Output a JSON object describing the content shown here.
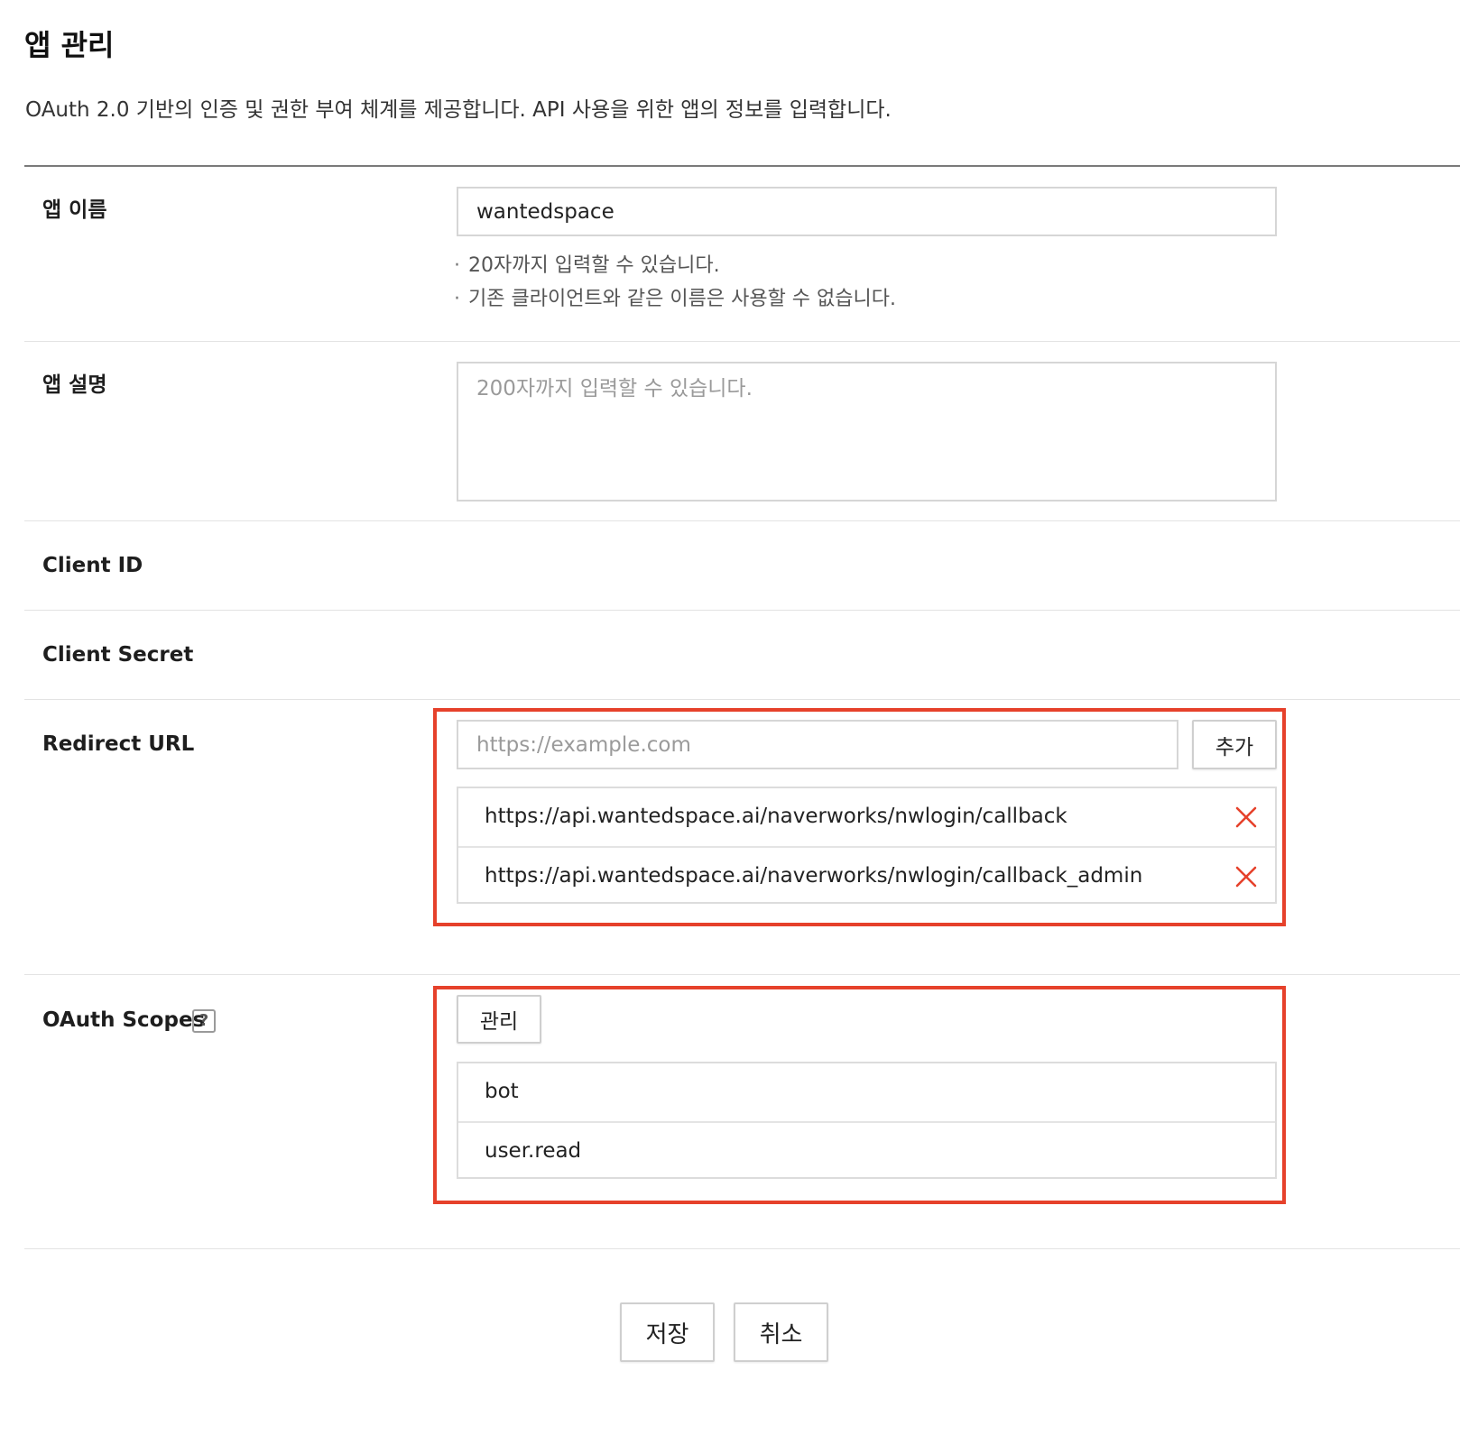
{
  "page": {
    "title": "앱 관리",
    "description": "OAuth 2.0 기반의 인증 및 권한 부여 체계를 제공합니다. API 사용을 위한 앱의 정보를 입력합니다."
  },
  "app_name": {
    "label": "앱 이름",
    "value": "wantedspace",
    "hints": [
      "20자까지 입력할 수 있습니다.",
      "기존 클라이언트와 같은 이름은 사용할 수 없습니다."
    ]
  },
  "app_description": {
    "label": "앱 설명",
    "value": "",
    "placeholder": "200자까지 입력할 수 있습니다."
  },
  "client_id": {
    "label": "Client ID",
    "value": ""
  },
  "client_secret": {
    "label": "Client Secret",
    "value": ""
  },
  "redirect_url": {
    "label": "Redirect URL",
    "input_value": "",
    "placeholder": "https://example.com",
    "add_label": "추가",
    "urls": [
      "https://api.wantedspace.ai/naverworks/nwlogin/callback",
      "https://api.wantedspace.ai/naverworks/nwlogin/callback_admin"
    ],
    "remove_icon": "close-icon"
  },
  "oauth_scopes": {
    "label": "OAuth Scopes",
    "help_glyph": "?",
    "manage_label": "관리",
    "scopes": [
      "bot",
      "user.read"
    ]
  },
  "actions": {
    "save_label": "저장",
    "cancel_label": "취소"
  },
  "colors": {
    "highlight": "#e6412b",
    "remove_icon": "#e6412b",
    "border": "#d6d6d6"
  }
}
